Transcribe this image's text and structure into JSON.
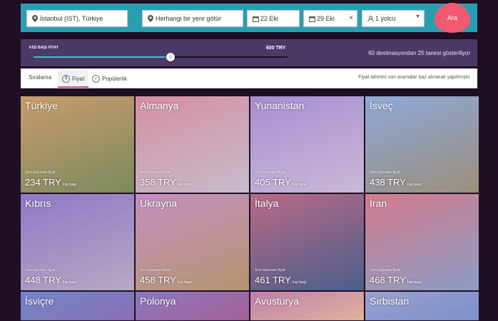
{
  "search": {
    "origin": "İstanbul (IST), Türkiye",
    "destination_placeholder": "Herhangi bir yere götür",
    "depart_date": "22 Eki",
    "return_date": "29 Eki",
    "passengers": "1 yolcu",
    "search_label": "Ara"
  },
  "price_filter": {
    "label": "KİŞİ BAŞI FİYAT",
    "value": "600 TRY",
    "slider_level": 0.54,
    "summary": "60 destinasyondan 25 tanesi gösteriliyor"
  },
  "sorting": {
    "label": "Sıralama",
    "options": [
      "Fiyat",
      "Popülerlik"
    ],
    "active": 0,
    "note": "Fiyat tahmini son aramalar baz alınarak yapılmıştır"
  },
  "destinations": [
    {
      "name": "Türkiye",
      "subtitle": "Son bulunan fiyat",
      "price": "234 TRY",
      "per": "kişi başı",
      "colors": [
        "#c99c6d",
        "#7a8a5e"
      ]
    },
    {
      "name": "Almanya",
      "subtitle": "Son bulunan fiyat",
      "price": "358 TRY",
      "per": "kişi başı",
      "colors": [
        "#d58fa4",
        "#c6bcc9"
      ]
    },
    {
      "name": "Yunanistan",
      "subtitle": "Son bulunan fiyat",
      "price": "405 TRY",
      "per": "kişi başı",
      "colors": [
        "#a98ed3",
        "#c9b9d6"
      ]
    },
    {
      "name": "İsveç",
      "subtitle": "Son bulunan fiyat",
      "price": "438 TRY",
      "per": "kişi başı",
      "colors": [
        "#8fa8d8",
        "#9b8f7c"
      ]
    },
    {
      "name": "Kıbrıs",
      "subtitle": "Son bulunan fiyat",
      "price": "448 TRY",
      "per": "kişi başı",
      "colors": [
        "#8f79c7",
        "#b6a9c2"
      ]
    },
    {
      "name": "Ukrayna",
      "subtitle": "Son bulunan fiyat",
      "price": "458 TRY",
      "per": "kişi başı",
      "colors": [
        "#c58fc0",
        "#b59670"
      ]
    },
    {
      "name": "İtalya",
      "subtitle": "Son bulunan fiyat",
      "price": "461 TRY",
      "per": "kişi başı",
      "colors": [
        "#b96a86",
        "#4a5f8c"
      ]
    },
    {
      "name": "İran",
      "subtitle": "Son bulunan fiyat",
      "price": "468 TRY",
      "per": "kişi başı",
      "colors": [
        "#d37c8c",
        "#8c9dc5"
      ]
    },
    {
      "name": "İsviçre",
      "subtitle": "",
      "price": "",
      "per": "",
      "colors": [
        "#6f86c9",
        "#8b6fb3"
      ]
    },
    {
      "name": "Polonya",
      "subtitle": "",
      "price": "",
      "per": "",
      "colors": [
        "#8a79c4",
        "#a65f95"
      ]
    },
    {
      "name": "Avusturya",
      "subtitle": "",
      "price": "",
      "per": "",
      "colors": [
        "#c07fae",
        "#e0b39a"
      ]
    },
    {
      "name": "Sırbistan",
      "subtitle": "",
      "price": "",
      "per": "",
      "colors": [
        "#9aa0d0",
        "#7d90c8"
      ]
    }
  ],
  "colors": {
    "search_bar": "#2a9db1",
    "search_button": "#f25a6f",
    "price_panel": "#4c3a66",
    "slider_fill": "#4fb8cf",
    "active_tab_accent": "#d6507a"
  }
}
